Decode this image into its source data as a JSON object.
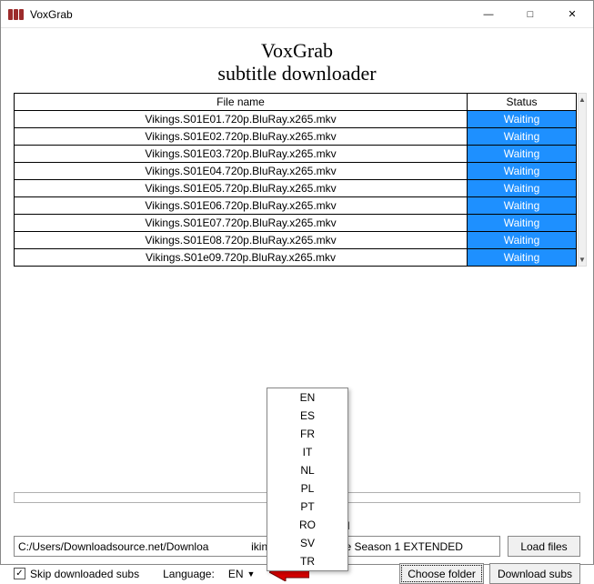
{
  "window": {
    "title": "VoxGrab"
  },
  "header": {
    "title": "VoxGrab",
    "subtitle": "subtitle downloader"
  },
  "table": {
    "columns": {
      "file": "File name",
      "status": "Status"
    },
    "rows": [
      {
        "file": "Vikings.S01E01.720p.BluRay.x265.mkv",
        "status": "Waiting"
      },
      {
        "file": "Vikings.S01E02.720p.BluRay.x265.mkv",
        "status": "Waiting"
      },
      {
        "file": "Vikings.S01E03.720p.BluRay.x265.mkv",
        "status": "Waiting"
      },
      {
        "file": "Vikings.S01E04.720p.BluRay.x265.mkv",
        "status": "Waiting"
      },
      {
        "file": "Vikings.S01E05.720p.BluRay.x265.mkv",
        "status": "Waiting"
      },
      {
        "file": "Vikings.S01E06.720p.BluRay.x265.mkv",
        "status": "Waiting"
      },
      {
        "file": "Vikings.S01E07.720p.BluRay.x265.mkv",
        "status": "Waiting"
      },
      {
        "file": "Vikings.S01E08.720p.BluRay.x265.mkv",
        "status": "Waiting"
      },
      {
        "file": "Vikings.S01e09.720p.BluRay.x265.mkv",
        "status": "Waiting"
      }
    ]
  },
  "download_check_fragment": "Download",
  "path": {
    "value": "C:/Users/Downloadsource.net/Downloa              ikings S01 Complete Season 1 EXTENDED"
  },
  "buttons": {
    "load_files": "Load files",
    "choose_folder": "Choose folder",
    "download_subs": "Download subs"
  },
  "options": {
    "skip_label": "Skip downloaded subs",
    "skip_checked": "✓",
    "language_label": "Language:",
    "language_selected": "EN",
    "language_menu": [
      "EN",
      "ES",
      "FR",
      "IT",
      "NL",
      "PL",
      "PT",
      "RO",
      "SV",
      "TR"
    ]
  }
}
